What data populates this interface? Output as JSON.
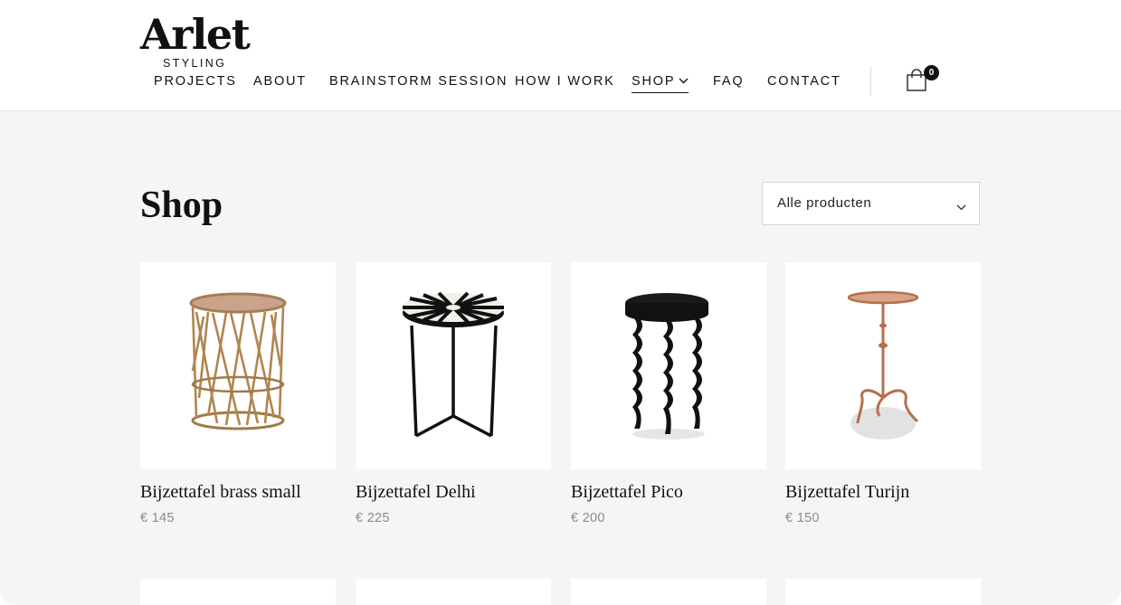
{
  "brand": {
    "name": "Arlet",
    "tagline": "STYLING"
  },
  "nav": {
    "items": [
      {
        "label": "PROJECTS"
      },
      {
        "label": "ABOUT"
      },
      {
        "label": "BRAINSTORM SESSION"
      },
      {
        "label": "HOW I WORK"
      },
      {
        "label": "SHOP",
        "active": true,
        "has_dropdown": true
      },
      {
        "label": "FAQ"
      },
      {
        "label": "CONTACT"
      }
    ]
  },
  "cart": {
    "count": "0",
    "icon": "shopping-bag-icon"
  },
  "page": {
    "title": "Shop"
  },
  "filter": {
    "selected": "Alle producten",
    "icon": "chevron-down-icon"
  },
  "products": [
    {
      "name": "Bijzettafel brass small",
      "price": "€ 145"
    },
    {
      "name": "Bijzettafel Delhi",
      "price": "€ 225"
    },
    {
      "name": "Bijzettafel Pico",
      "price": "€ 200"
    },
    {
      "name": "Bijzettafel Turijn",
      "price": "€ 150"
    }
  ],
  "colors": {
    "background": "#f5f5f5",
    "text": "#111111",
    "price": "#8a8a8a",
    "accent": "#111111"
  }
}
